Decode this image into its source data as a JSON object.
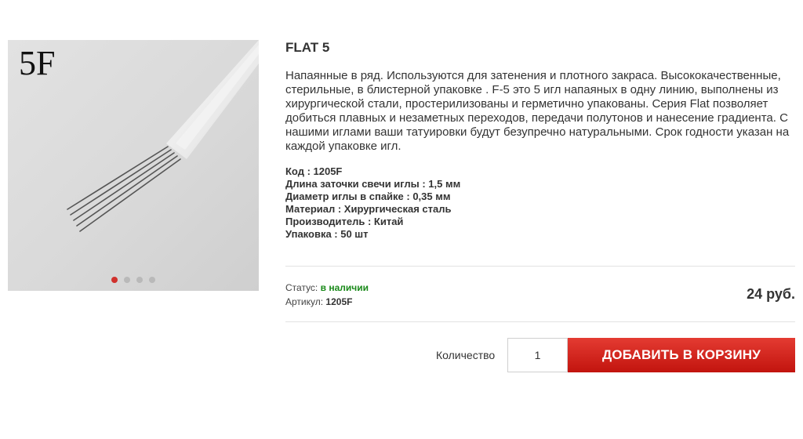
{
  "product": {
    "image_label": "5F",
    "title": "FLAT 5",
    "description": "Напаянные в ряд. Используются для затенения и плотного закраса. Высококачественные, стерильные, в блистерной упаковке . F-5 это 5 игл напаяных в одну линию, выполнены из хирургической стали, простерилизованы и герметично упакованы. Серия Flat позволяет добиться плавных и незаметных переходов, передачи полутонов и нанесение градиента. С нашими иглами ваши татуировки будут безупречно натуральными. Срок годности указан на каждой упаковке игл.",
    "specs": [
      "Код : 1205F",
      "Длина заточки свечи иглы : 1,5 мм",
      "Диаметр иглы в спайке : 0,35 мм",
      "Материал : Хирургическая сталь",
      "Производитель : Китай",
      "Упаковка : 50 шт"
    ],
    "status_label": "Статус:",
    "status_value": "в наличии",
    "article_label": "Артикул:",
    "article_value": "1205F",
    "price": "24 руб."
  },
  "gallery": {
    "slides_count": 4,
    "active_index": 0
  },
  "purchase": {
    "quantity_label": "Количество",
    "quantity_value": "1",
    "add_button_label": "ДОБАВИТЬ В КОРЗИНУ"
  },
  "colors": {
    "accent": "#d0312d",
    "status_green": "#1a8a1a",
    "button_top": "#e43b32",
    "button_bottom": "#c2140e"
  }
}
